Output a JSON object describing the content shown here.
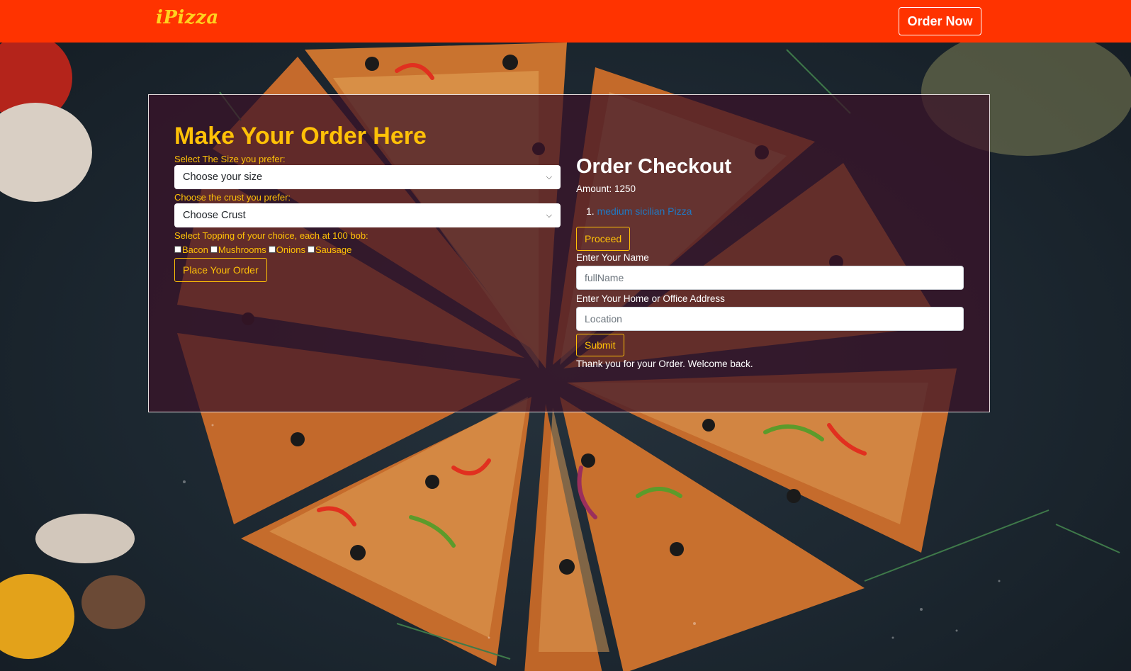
{
  "navbar": {
    "brand": "iPizza",
    "cta_label": "Order Now"
  },
  "order_form": {
    "title": "Make Your Order Here",
    "size_label": "Select The Size you prefer:",
    "size_selected": "Choose your size",
    "crust_label": "Choose the crust you prefer:",
    "crust_selected": "Choose Crust",
    "toppings_label": "Select Topping of your choice, each at 100 bob:",
    "toppings": [
      "Bacon",
      "Mushrooms",
      "Onions",
      "Sausage"
    ],
    "submit_label": "Place Your Order"
  },
  "checkout": {
    "title": "Order Checkout",
    "amount": "Amount: 1250",
    "items": [
      {
        "number": "1.",
        "name": "medium sicilian Pizza"
      }
    ],
    "proceed_label": "Proceed",
    "name_label": "Enter Your Name",
    "name_placeholder": "fullName",
    "address_label": "Enter Your Home or Office Address",
    "address_placeholder": "Location",
    "submit_label": "Submit",
    "thank_you": "Thank you for your Order. Welcome back."
  },
  "colors": {
    "navbar_bg": "#ff3300",
    "brand": "#ffd21f",
    "accent_gold": "#ffc107",
    "link_blue": "#1f79c4",
    "panel_overlay": "#3a1228"
  }
}
